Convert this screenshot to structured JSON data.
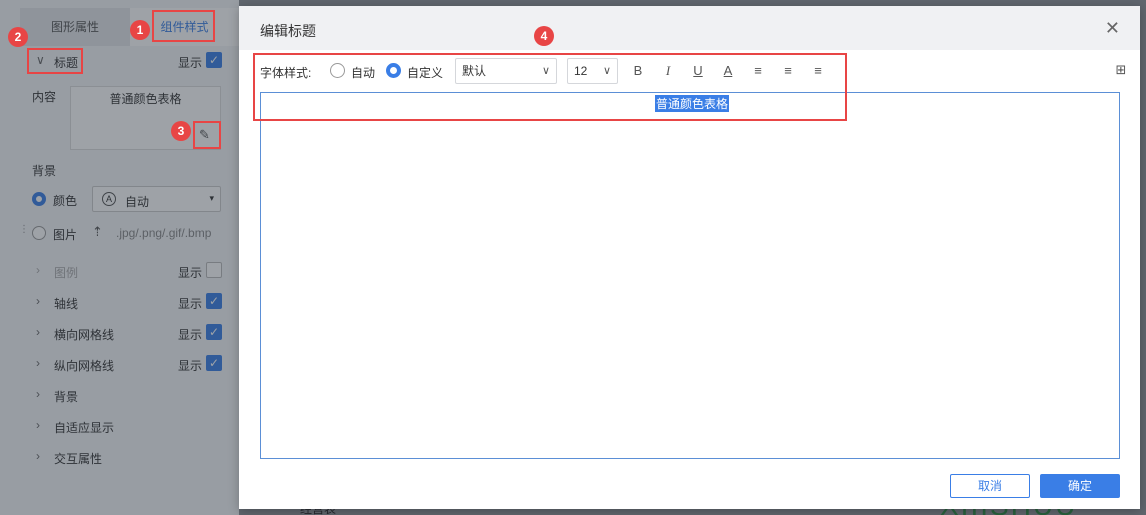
{
  "panel": {
    "tabs": [
      "图形属性",
      "组件样式"
    ],
    "title_section": {
      "label": "标题",
      "show": "显示"
    },
    "content_label": "内容",
    "content_value": "普通颜色表格",
    "background_label": "背景",
    "color_option": "颜色",
    "color_select": "自动",
    "image_option": "图片",
    "image_hint": ".jpg/.png/.gif/.bmp",
    "sections": [
      {
        "label": "图例",
        "show": "显示",
        "checked": false,
        "muted": true
      },
      {
        "label": "轴线",
        "show": "显示",
        "checked": true
      },
      {
        "label": "横向网格线",
        "show": "显示",
        "checked": true
      },
      {
        "label": "纵向网格线",
        "show": "显示",
        "checked": true
      },
      {
        "label": "背景"
      },
      {
        "label": "自适应显示"
      },
      {
        "label": "交互属性"
      }
    ]
  },
  "dialog": {
    "title": "编辑标题",
    "font_style_label": "字体样式:",
    "radio_auto": "自动",
    "radio_custom": "自定义",
    "font_family": "默认",
    "font_size": "12",
    "editor_text": "普通颜色表格",
    "cancel_label": "取消",
    "ok_label": "确定"
  },
  "background_text": {
    "left": "经营表",
    "right": "XIIISHUU"
  },
  "annotations": [
    "1",
    "2",
    "3",
    "4"
  ],
  "colors": {
    "accent": "#3a7ee6",
    "annotation": "#e84545"
  }
}
